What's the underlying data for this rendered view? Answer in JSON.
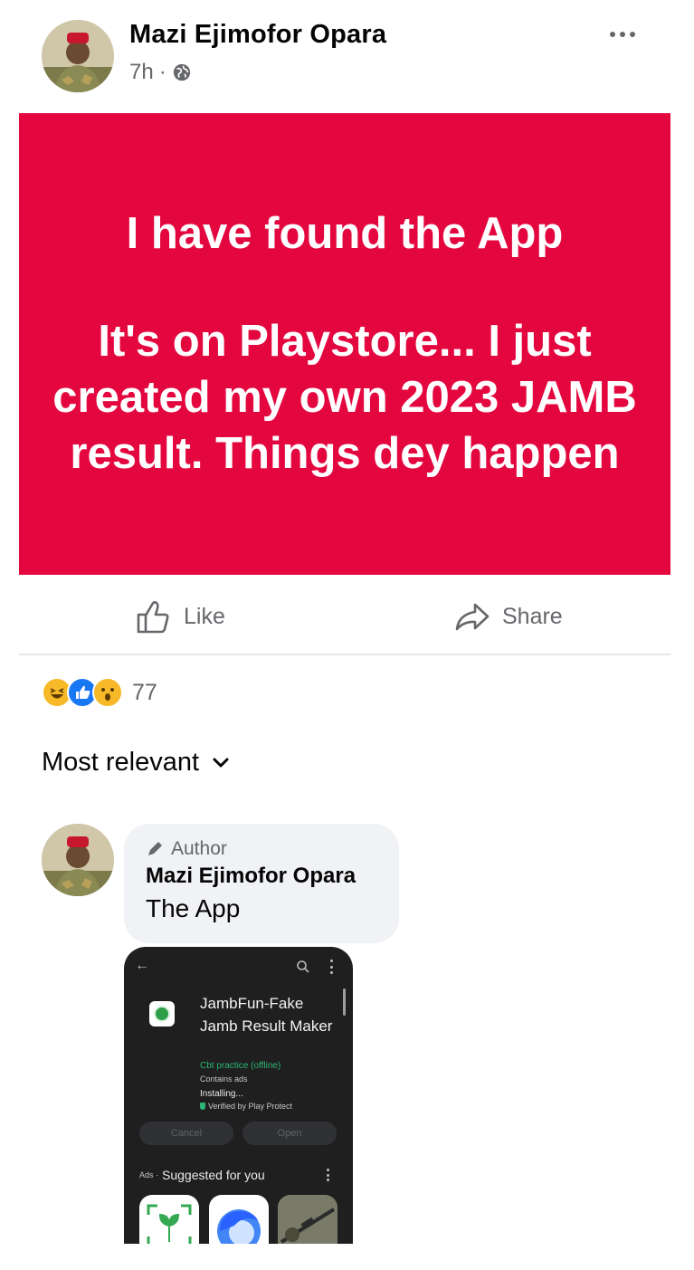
{
  "post": {
    "author": "Mazi Ejimofor Opara",
    "time": "7h",
    "separator": "·",
    "privacy_icon": "globe-icon",
    "card_line1": "I have found the App",
    "card_line2": "It's on Playstore... I just created my own 2023 JAMB result. Things dey happen",
    "card_color": "#e3063f"
  },
  "actions": {
    "like_label": "Like",
    "share_label": "Share"
  },
  "reactions": {
    "icons": [
      "haha-icon",
      "like-icon",
      "wow-icon"
    ],
    "count": "77"
  },
  "comments_sort": {
    "label": "Most relevant"
  },
  "comment": {
    "badge": "Author",
    "author": "Mazi Ejimofor Opara",
    "text": "The App"
  },
  "attachment": {
    "app_title": "JambFun-Fake Jamb Result Maker",
    "developer": "Cbt practice (offline)",
    "contains_ads": "Contains ads",
    "status": "Installing...",
    "verified": "Verified by Play Protect",
    "cancel_label": "Cancel",
    "open_label": "Open",
    "ads_tag": "Ads ·",
    "suggested_label": "Suggested for you"
  }
}
